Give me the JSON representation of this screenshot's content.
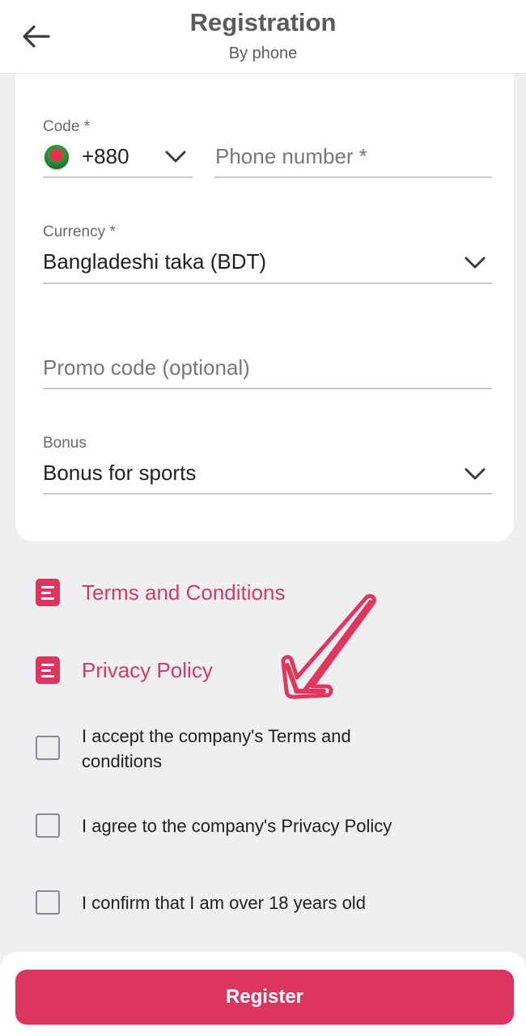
{
  "header": {
    "title": "Registration",
    "subtitle": "By phone",
    "back_icon": "arrow-left-icon"
  },
  "form": {
    "code": {
      "label": "Code *",
      "value": "+880",
      "flag_icon": "bangladesh-flag-icon"
    },
    "phone": {
      "placeholder": "Phone number *",
      "value": ""
    },
    "currency": {
      "label": "Currency *",
      "value": "Bangladeshi taka (BDT)"
    },
    "promo": {
      "placeholder": "Promo code (optional)",
      "value": ""
    },
    "bonus": {
      "label": "Bonus",
      "value": "Bonus for sports"
    }
  },
  "links": {
    "terms": "Terms and Conditions",
    "privacy": "Privacy Policy"
  },
  "checks": [
    {
      "label": "I accept the company's Terms and conditions",
      "checked": false
    },
    {
      "label": "I agree to the company's Privacy Policy",
      "checked": false
    },
    {
      "label": "I confirm that I am over 18 years old",
      "checked": false
    }
  ],
  "actions": {
    "register_label": "Register"
  },
  "colors": {
    "accent": "#dc3660",
    "background": "#efeff1",
    "card": "#ffffff",
    "muted_text": "#6a6a6e"
  }
}
